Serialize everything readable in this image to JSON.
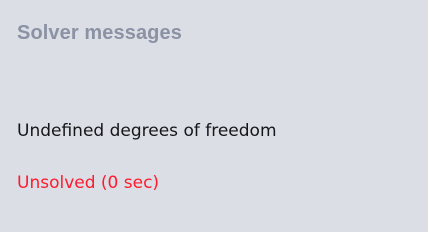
{
  "panel": {
    "title": "Solver messages",
    "messages": {
      "dof": "Undefined degrees of freedom",
      "status": "Unsolved (0 sec)"
    },
    "colors": {
      "background": "#dcdee5",
      "title": "#8b92a4",
      "text": "#15161a",
      "error": "#ff1a2e"
    }
  }
}
